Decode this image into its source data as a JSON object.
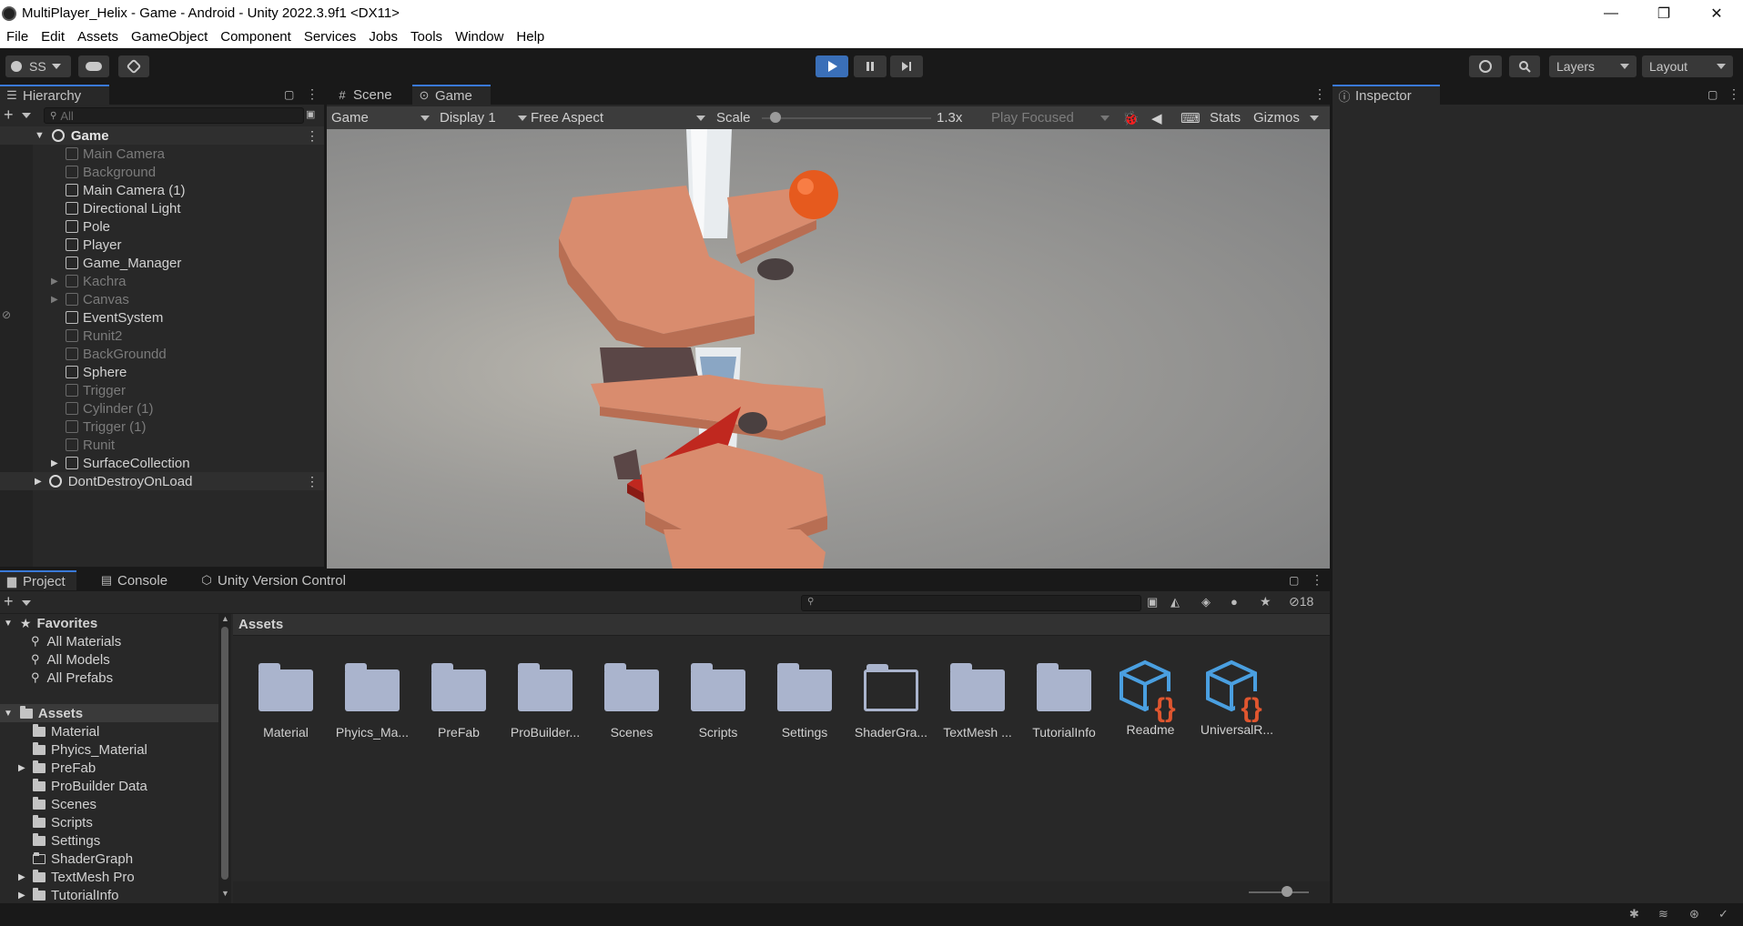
{
  "window": {
    "title": "MultiPlayer_Helix - Game - Android - Unity 2022.3.9f1 <DX11>",
    "minimize": "—",
    "maximize": "❐",
    "close": "✕"
  },
  "menu": [
    "File",
    "Edit",
    "Assets",
    "GameObject",
    "Component",
    "Services",
    "Jobs",
    "Tools",
    "Window",
    "Help"
  ],
  "toolbar": {
    "account": "SS",
    "layers": "Layers",
    "layout": "Layout",
    "play_state": "play"
  },
  "hierarchy": {
    "tab": "Hierarchy",
    "search_placeholder": "All",
    "scene": "Game",
    "items": [
      {
        "label": "Main Camera",
        "dim": true
      },
      {
        "label": "Background",
        "dim": true
      },
      {
        "label": "Main Camera (1)",
        "dim": false
      },
      {
        "label": "Directional Light",
        "dim": false
      },
      {
        "label": "Pole",
        "dim": false
      },
      {
        "label": "Player",
        "dim": false
      },
      {
        "label": "Game_Manager",
        "dim": false
      },
      {
        "label": "Kachra",
        "dim": true,
        "expandable": true
      },
      {
        "label": "Canvas",
        "dim": true,
        "expandable": true
      },
      {
        "label": "EventSystem",
        "dim": false
      },
      {
        "label": "Runit2",
        "dim": true
      },
      {
        "label": "BackGroundd",
        "dim": true
      },
      {
        "label": "Sphere",
        "dim": false
      },
      {
        "label": "Trigger",
        "dim": true
      },
      {
        "label": "Cylinder (1)",
        "dim": true
      },
      {
        "label": "Trigger (1)",
        "dim": true
      },
      {
        "label": "Runit",
        "dim": true
      },
      {
        "label": "SurfaceCollection",
        "dim": false,
        "expandable": true
      }
    ],
    "dontdestroy": "DontDestroyOnLoad"
  },
  "center_tabs": {
    "scene": "Scene",
    "game": "Game"
  },
  "game_toolbar": {
    "mode": "Game",
    "display": "Display 1",
    "aspect": "Free Aspect",
    "scale_label": "Scale",
    "scale_value": "1.3x",
    "scale_fraction": 0.05,
    "play_focused": "Play Focused",
    "stats": "Stats",
    "gizmos": "Gizmos"
  },
  "inspector": {
    "tab": "Inspector"
  },
  "project": {
    "tabs": [
      "Project",
      "Console",
      "Unity Version Control"
    ],
    "hidden_count": "18",
    "favorites_label": "Favorites",
    "favorites": [
      "All Materials",
      "All Models",
      "All Prefabs"
    ],
    "assets_label": "Assets",
    "tree": [
      {
        "label": "Material",
        "expandable": false,
        "outline": false
      },
      {
        "label": "Phyics_Material",
        "expandable": false,
        "outline": false
      },
      {
        "label": "PreFab",
        "expandable": true,
        "outline": false
      },
      {
        "label": "ProBuilder Data",
        "expandable": false,
        "outline": false
      },
      {
        "label": "Scenes",
        "expandable": false,
        "outline": false
      },
      {
        "label": "Scripts",
        "expandable": false,
        "outline": false
      },
      {
        "label": "Settings",
        "expandable": false,
        "outline": false
      },
      {
        "label": "ShaderGraph",
        "expandable": false,
        "outline": true
      },
      {
        "label": "TextMesh Pro",
        "expandable": true,
        "outline": false
      },
      {
        "label": "TutorialInfo",
        "expandable": true,
        "outline": false
      }
    ],
    "breadcrumb": "Assets",
    "grid": [
      {
        "label": "Material",
        "kind": "folder"
      },
      {
        "label": "Phyics_Ma...",
        "kind": "folder"
      },
      {
        "label": "PreFab",
        "kind": "folder"
      },
      {
        "label": "ProBuilder...",
        "kind": "folder"
      },
      {
        "label": "Scenes",
        "kind": "folder"
      },
      {
        "label": "Scripts",
        "kind": "folder"
      },
      {
        "label": "Settings",
        "kind": "folder"
      },
      {
        "label": "ShaderGra...",
        "kind": "folder-outline"
      },
      {
        "label": "TextMesh ...",
        "kind": "folder"
      },
      {
        "label": "TutorialInfo",
        "kind": "folder"
      },
      {
        "label": "Readme",
        "kind": "script"
      },
      {
        "label": "UniversalR...",
        "kind": "script"
      }
    ]
  },
  "colors": {
    "accent": "#3a79d8",
    "play_active": "#3a6fb8",
    "folder": "#aab4cd",
    "script_cube": "#4a9fe0",
    "script_braces": "#e0562f"
  }
}
